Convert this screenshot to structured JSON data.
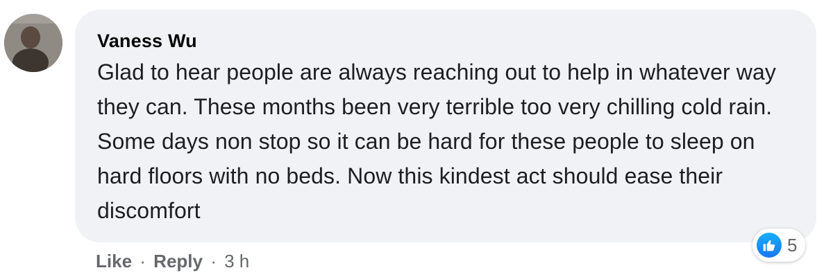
{
  "comment": {
    "author": "Vaness Wu",
    "text": "Glad to hear people are always reaching out to help in whatever way they can. These months been very terrible too very chilling cold rain. Some days non stop so it can be hard for these people to sleep on hard floors with no beds. Now this kindest act should ease their discomfort",
    "avatar_icon": "profile-photo",
    "bubble_color": "#f0f2f5"
  },
  "reactions": {
    "icon": "thumbs-up-icon",
    "count": "5",
    "color": "#1877f2"
  },
  "actions": {
    "like_label": "Like",
    "separator": "·",
    "reply_label": "Reply",
    "timestamp": "3 h"
  }
}
